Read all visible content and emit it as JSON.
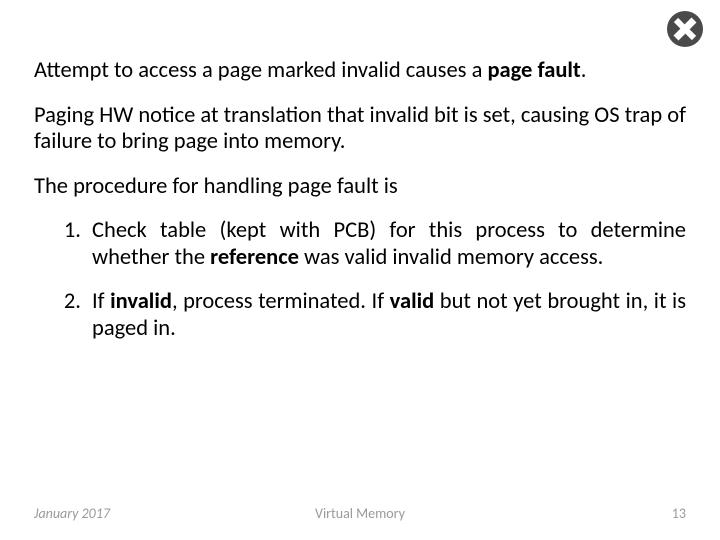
{
  "para1": {
    "pre": "Attempt to access a page marked invalid causes a ",
    "bold": "page fault",
    "post": "."
  },
  "para2": "Paging HW notice at translation that invalid bit is set, causing OS trap of failure to bring page into memory.",
  "para3": "The procedure for handling page fault is",
  "list": {
    "item1": {
      "a": "Check table (kept with PCB) for this process to determine whether the ",
      "b": "reference",
      "c": " was valid invalid memory access."
    },
    "item2": {
      "a": "If ",
      "b": "invalid",
      "c": ", process terminated. If ",
      "d": "valid",
      "e": " but not yet brought in, it is paged in."
    }
  },
  "footer": {
    "date": "January 2017",
    "title": "Virtual Memory",
    "page": "13"
  }
}
